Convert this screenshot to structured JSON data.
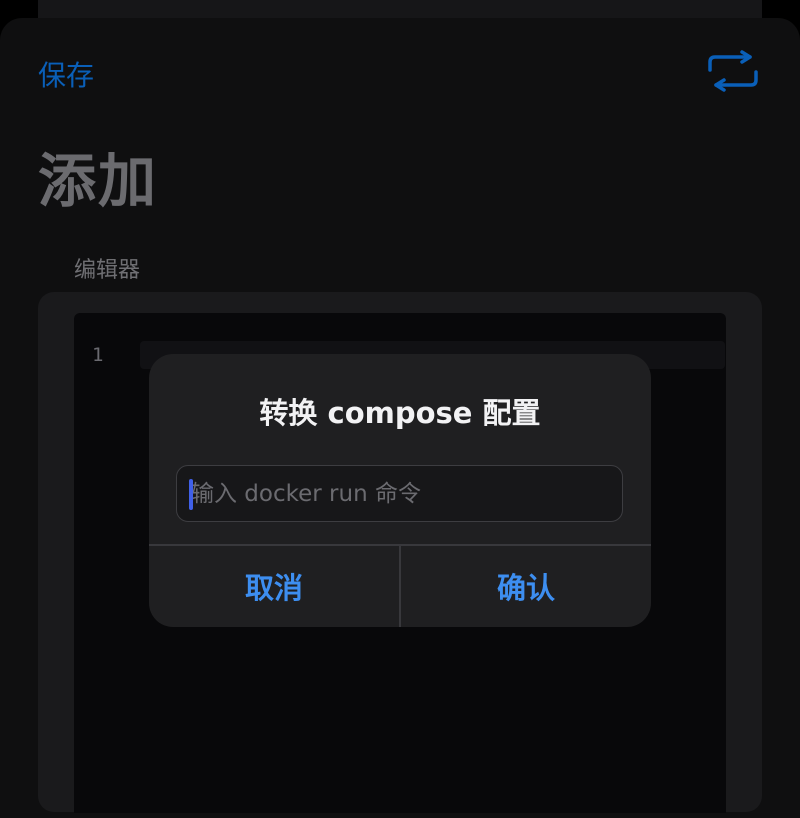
{
  "header": {
    "save_label": "保存",
    "convert_icon": "convert-arrows-icon",
    "title": "添加"
  },
  "editor": {
    "section_label": "编辑器",
    "line_numbers": [
      "1"
    ],
    "content": ""
  },
  "dialog": {
    "title": "转换 compose 配置",
    "input_value": "",
    "input_placeholder": "输入 docker run 命令",
    "cancel_label": "取消",
    "confirm_label": "确认"
  },
  "colors": {
    "accent": "#3d8ef0",
    "header_accent": "#0a5fb8",
    "caret": "#4060e8",
    "background": "#0f0f10",
    "dialog_background": "#1f1f21"
  }
}
